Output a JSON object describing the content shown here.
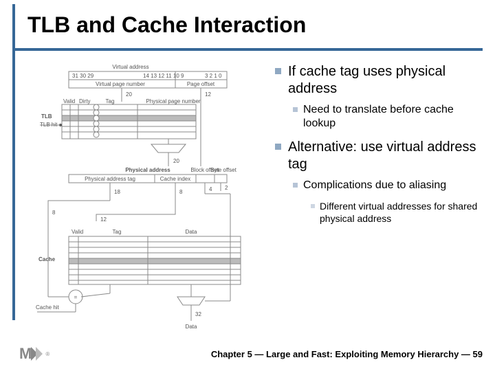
{
  "title": "TLB and Cache Interaction",
  "bullets": {
    "b1": "If cache tag uses physical address",
    "b1_1": "Need to translate before cache lookup",
    "b2": "Alternative: use virtual address tag",
    "b2_1": "Complications due to aliasing",
    "b2_1_1": "Different virtual addresses for shared physical address"
  },
  "diagram": {
    "virtual_address": "Virtual address",
    "bits_top": [
      "31 30 29",
      "14 13 12 11 10 9",
      "3 2 1 0"
    ],
    "virtual_page_number": "Virtual page number",
    "page_offset": "Page offset",
    "width_20": "20",
    "width_12": "12",
    "valid": "Valid",
    "dirty": "Dirty",
    "tag": "Tag",
    "tlb": "TLB",
    "tlb_hit": "TLB hit",
    "physical_page_number": "Physical page number",
    "physical_address": "Physical address",
    "physical_address_tag": "Physical address tag",
    "cache_index": "Cache index",
    "block_offset": "Block offset",
    "byte_offset": "Byte offset",
    "width_18": "18",
    "width_8": "8",
    "width_4": "4",
    "width_2": "2",
    "cache": "Cache",
    "data": "Data",
    "cache_hit": "Cache hit",
    "width_32": "32"
  },
  "footer": "Chapter 5 — Large and Fast: Exploiting Memory Hierarchy — 59"
}
